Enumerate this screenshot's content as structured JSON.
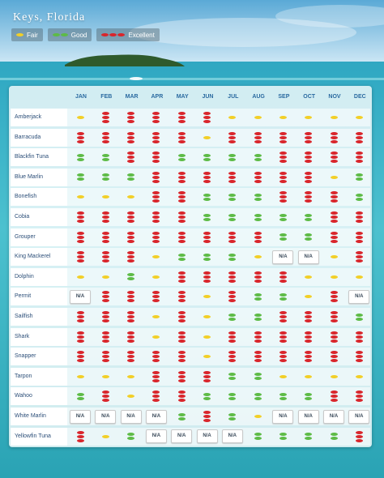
{
  "header": {
    "title": "Keys, Florida"
  },
  "legend": {
    "fair": {
      "label": "Fair",
      "color": "#f2cf27",
      "count": 1
    },
    "good": {
      "label": "Good",
      "color": "#5dbb46",
      "count": 2
    },
    "excellent": {
      "label": "Excellent",
      "color": "#d9252b",
      "count": 3
    }
  },
  "months": [
    "JAN",
    "FEB",
    "MAR",
    "APR",
    "MAY",
    "JUN",
    "JUL",
    "AUG",
    "SEP",
    "OCT",
    "NOV",
    "DEC"
  ],
  "na_label": "N/A",
  "species": [
    {
      "name": "Amberjack",
      "ratings": [
        "F",
        "E",
        "E",
        "E",
        "E",
        "E",
        "F",
        "F",
        "F",
        "F",
        "F",
        "F"
      ]
    },
    {
      "name": "Barracuda",
      "ratings": [
        "E",
        "E",
        "E",
        "E",
        "E",
        "F",
        "E",
        "E",
        "E",
        "E",
        "E",
        "E"
      ]
    },
    {
      "name": "Blackfin Tuna",
      "ratings": [
        "G",
        "G",
        "E",
        "E",
        "G",
        "G",
        "G",
        "G",
        "E",
        "E",
        "E",
        "E"
      ]
    },
    {
      "name": "Blue Marlin",
      "ratings": [
        "G",
        "G",
        "G",
        "E",
        "E",
        "E",
        "E",
        "E",
        "E",
        "E",
        "F",
        "G"
      ]
    },
    {
      "name": "Bonefish",
      "ratings": [
        "F",
        "F",
        "F",
        "E",
        "E",
        "G",
        "G",
        "G",
        "E",
        "E",
        "E",
        "G"
      ]
    },
    {
      "name": "Cobia",
      "ratings": [
        "E",
        "E",
        "E",
        "E",
        "E",
        "G",
        "G",
        "G",
        "G",
        "G",
        "E",
        "E"
      ]
    },
    {
      "name": "Grouper",
      "ratings": [
        "E",
        "E",
        "E",
        "E",
        "E",
        "E",
        "E",
        "E",
        "G",
        "G",
        "E",
        "E"
      ]
    },
    {
      "name": "King Mackerel",
      "ratings": [
        "E",
        "E",
        "E",
        "F",
        "G",
        "G",
        "G",
        "F",
        "NA",
        "NA",
        "F",
        "E"
      ]
    },
    {
      "name": "Dolphin",
      "ratings": [
        "F",
        "F",
        "G",
        "F",
        "E",
        "E",
        "E",
        "E",
        "E",
        "F",
        "F",
        "F"
      ]
    },
    {
      "name": "Permit",
      "ratings": [
        "NA",
        "E",
        "E",
        "E",
        "E",
        "F",
        "E",
        "G",
        "G",
        "F",
        "E",
        "NA"
      ]
    },
    {
      "name": "Sailfish",
      "ratings": [
        "E",
        "E",
        "E",
        "F",
        "E",
        "F",
        "G",
        "G",
        "E",
        "E",
        "E",
        "G"
      ]
    },
    {
      "name": "Shark",
      "ratings": [
        "E",
        "E",
        "E",
        "F",
        "E",
        "F",
        "E",
        "E",
        "E",
        "E",
        "E",
        "E"
      ]
    },
    {
      "name": "Snapper",
      "ratings": [
        "E",
        "E",
        "E",
        "E",
        "E",
        "F",
        "E",
        "E",
        "E",
        "E",
        "E",
        "E"
      ]
    },
    {
      "name": "Tarpon",
      "ratings": [
        "F",
        "F",
        "F",
        "E",
        "E",
        "E",
        "G",
        "G",
        "F",
        "F",
        "F",
        "F"
      ]
    },
    {
      "name": "Wahoo",
      "ratings": [
        "G",
        "E",
        "F",
        "E",
        "E",
        "G",
        "G",
        "G",
        "G",
        "G",
        "E",
        "E"
      ]
    },
    {
      "name": "White Marlin",
      "ratings": [
        "NA",
        "NA",
        "NA",
        "NA",
        "G",
        "E",
        "G",
        "F",
        "NA",
        "NA",
        "NA",
        "NA"
      ]
    },
    {
      "name": "Yellowfin Tuna",
      "ratings": [
        "E",
        "F",
        "G",
        "NA",
        "NA",
        "NA",
        "NA",
        "G",
        "G",
        "G",
        "G",
        "E"
      ]
    }
  ]
}
